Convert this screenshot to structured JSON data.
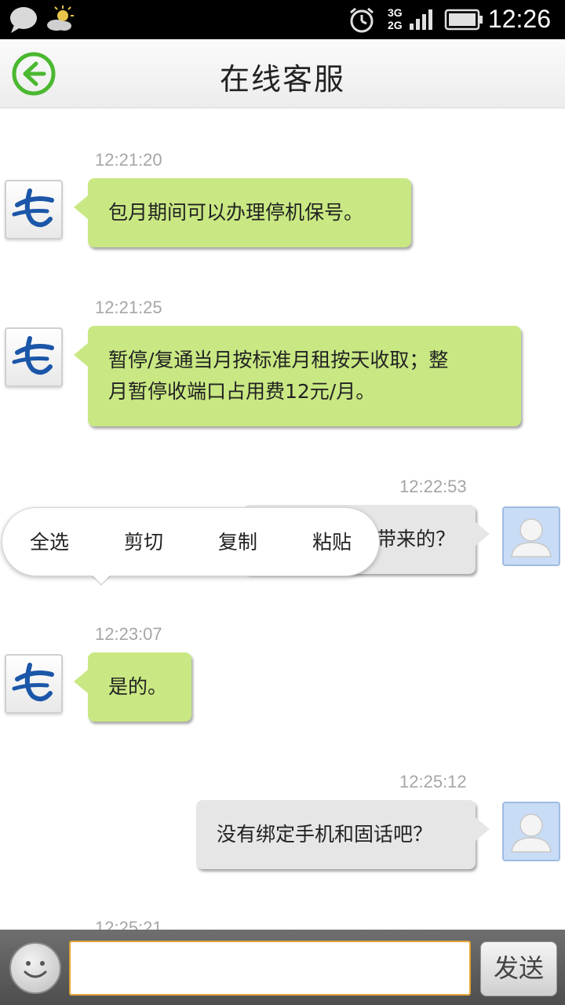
{
  "status_bar": {
    "time": "12:26",
    "network_top": "3G",
    "network_bottom": "2G",
    "icons": [
      "chat-bubble-icon",
      "weather-sun-cloud-icon",
      "alarm-icon",
      "signal-icon",
      "battery-icon"
    ]
  },
  "header": {
    "title": "在线客服",
    "back_icon": "back-arrow-icon",
    "accent_color": "#4ab830"
  },
  "messages": [
    {
      "side": "left",
      "time": "12:21:20",
      "lines": [
        "包月期间可以办理停机保号。"
      ]
    },
    {
      "side": "left",
      "time": "12:21:25",
      "lines": [
        "暂停/复通当月按标准月租按天收取；整",
        "月暂停收端口占用费12元/月。"
      ]
    },
    {
      "side": "right",
      "time": "12:22:53",
      "lines": [
        "带来的？"
      ]
    },
    {
      "side": "left",
      "time": "12:23:07",
      "lines": [
        "是的。"
      ]
    },
    {
      "side": "right",
      "time": "12:25:12",
      "lines": [
        "没有绑定手机和固话吧？"
      ]
    },
    {
      "side": "left",
      "time": "12:25:21",
      "lines": []
    }
  ],
  "context_menu": {
    "items": [
      "全选",
      "剪切",
      "复制",
      "粘贴"
    ]
  },
  "input_bar": {
    "emoji_icon": "emoji-smiley-icon",
    "input_value": "",
    "send_label": "发送"
  },
  "colors": {
    "agent_bubble": "#c9e883",
    "user_bubble": "#e6e6e6",
    "input_border": "#e2a536"
  }
}
